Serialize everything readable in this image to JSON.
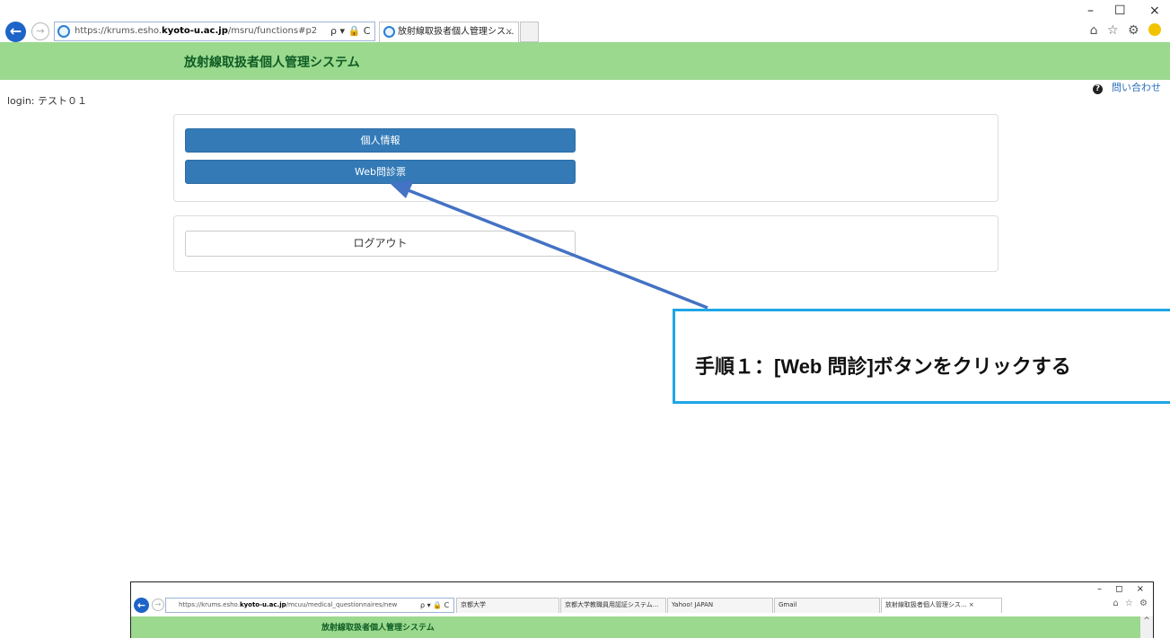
{
  "browser": {
    "back_icon": "arrow-left-icon",
    "forward_icon": "arrow-right-icon",
    "url_prefix": "https://krums.esho.",
    "url_domain": "kyoto-u.ac.jp",
    "url_path": "/msru/functions#p2",
    "addr_tools": "ρ ▾ 🔒 C",
    "tab_title": "放射線取扱者個人管理シス...",
    "tab_close": "×",
    "win_minimize": "–",
    "win_maximize": "☐",
    "win_close": "×",
    "right_icons": "⌂ ☆ ⚙"
  },
  "app": {
    "title": "放射線取扱者個人管理システム",
    "contact_label": "問い合わせ",
    "login_label": "login: テスト０１"
  },
  "menu": {
    "personal_info": "個人情報",
    "web_questionnaire": "Web問診票",
    "logout": "ログアウト"
  },
  "annotation": {
    "callout_text": "手順１：[Web 問診]ボタンをクリックする",
    "arrow_color": "#4472c4",
    "border_color": "#1ea6e6"
  },
  "embedded": {
    "url_prefix": "https://krums.esho.",
    "url_domain": "kyoto-u.ac.jp",
    "url_path": "/mcuu/medical_questionnaires/new",
    "addr_tools": "ρ ▾ 🔒 C",
    "tabs": [
      "京都大学",
      "京都大学教職員用認証システム...",
      "Yahoo! JAPAN",
      "Gmail",
      "放射線取扱者個人管理シス...  ×"
    ],
    "win_controls": "–  ◻  ×",
    "right_icons": "⌂ ☆ ⚙",
    "app_title": "放射線取扱者個人管理システム",
    "scroll_up": "^"
  },
  "colors": {
    "header_green": "#9bd98e",
    "primary_blue": "#337ab7",
    "link_blue": "#2a6ebb"
  }
}
